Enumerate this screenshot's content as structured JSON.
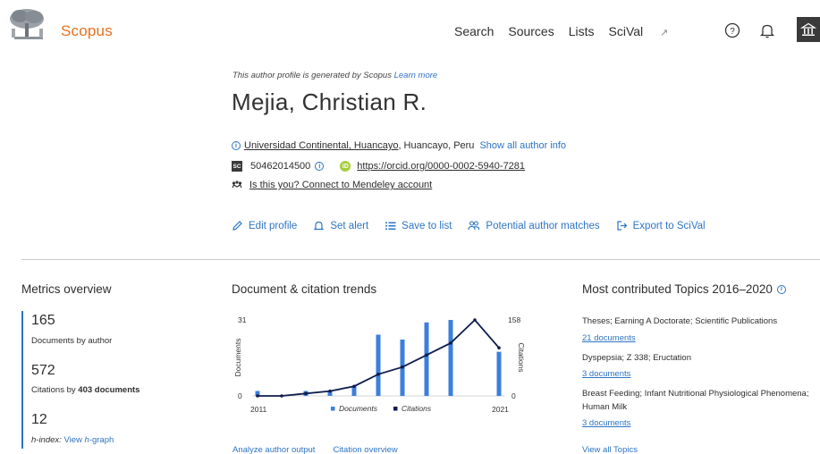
{
  "header": {
    "brand": "Scopus",
    "nav": [
      "Search",
      "Sources",
      "Lists",
      "SciVal"
    ],
    "nav_external_mark": "↗",
    "icons": [
      "help-icon",
      "bell-icon",
      "institution-icon"
    ]
  },
  "profile": {
    "generated_note": "This author profile is generated by Scopus",
    "learn_more": "Learn more",
    "name": "Mejia, Christian R.",
    "affiliation_link": "Universidad Continental, Huancayo",
    "affiliation_rest": ", Huancayo, Peru",
    "show_all_info": "Show all author info",
    "scopus_badge": "SC",
    "scopus_id": "50462014500",
    "orcid_badge": "iD",
    "orcid_url": "https://orcid.org/0000-0002-5940-7281",
    "mendeley_link": "Is this you? Connect to Mendeley account"
  },
  "actions": [
    {
      "label": "Edit profile",
      "icon": "pencil-icon"
    },
    {
      "label": "Set alert",
      "icon": "bell-icon"
    },
    {
      "label": "Save to list",
      "icon": "list-icon"
    },
    {
      "label": "Potential author matches",
      "icon": "people-icon"
    },
    {
      "label": "Export to SciVal",
      "icon": "export-icon"
    }
  ],
  "metrics": {
    "title": "Metrics overview",
    "documents_value": "165",
    "documents_label": "Documents by author",
    "citations_value": "572",
    "citations_label_prefix": "Citations by ",
    "citations_label_bold": "403 documents",
    "hindex_value": "12",
    "hindex_label": "h-index:",
    "hindex_link_prefix": "View ",
    "hindex_link_italic": "h",
    "hindex_link_suffix": "-graph"
  },
  "trends": {
    "title": "Document & citation trends",
    "analyze_link": "Analyze author output",
    "citation_link": "Citation overview"
  },
  "chart_data": {
    "type": "bar",
    "x": [
      2011,
      2012,
      2013,
      2014,
      2015,
      2016,
      2017,
      2018,
      2019,
      2020,
      2021
    ],
    "series": [
      {
        "name": "Documents",
        "type": "bar",
        "axis": "left",
        "values": [
          2,
          0,
          2,
          2,
          4,
          25,
          23,
          30,
          31,
          0,
          18
        ]
      },
      {
        "name": "Citations",
        "type": "line",
        "axis": "right",
        "values": [
          0,
          0,
          5,
          10,
          20,
          45,
          60,
          85,
          110,
          158,
          100
        ]
      }
    ],
    "xlabel": "",
    "ylabel": "Documents",
    "y2label": "Citations",
    "ylim": [
      0,
      31
    ],
    "y2lim": [
      0,
      158
    ],
    "yticks": [
      "31",
      "0"
    ],
    "y2ticks": [
      "158",
      "0"
    ],
    "xticks": [
      "2011",
      "2021"
    ],
    "colors": {
      "Documents": "#3c7fdc",
      "Citations": "#0f1c4d"
    },
    "legend": "bottom"
  },
  "topics": {
    "title": "Most contributed Topics 2016–2020",
    "items": [
      {
        "title": "Theses; Earning A Doctorate; Scientific Publications",
        "docs": "21 documents"
      },
      {
        "title": "Dyspepsia; Z 338; Eructation",
        "docs": "3 documents"
      },
      {
        "title": "Breast Feeding; Infant Nutritional Physiological Phenomena; Human Milk",
        "docs": "3 documents"
      }
    ],
    "view_all": "View all Topics"
  }
}
